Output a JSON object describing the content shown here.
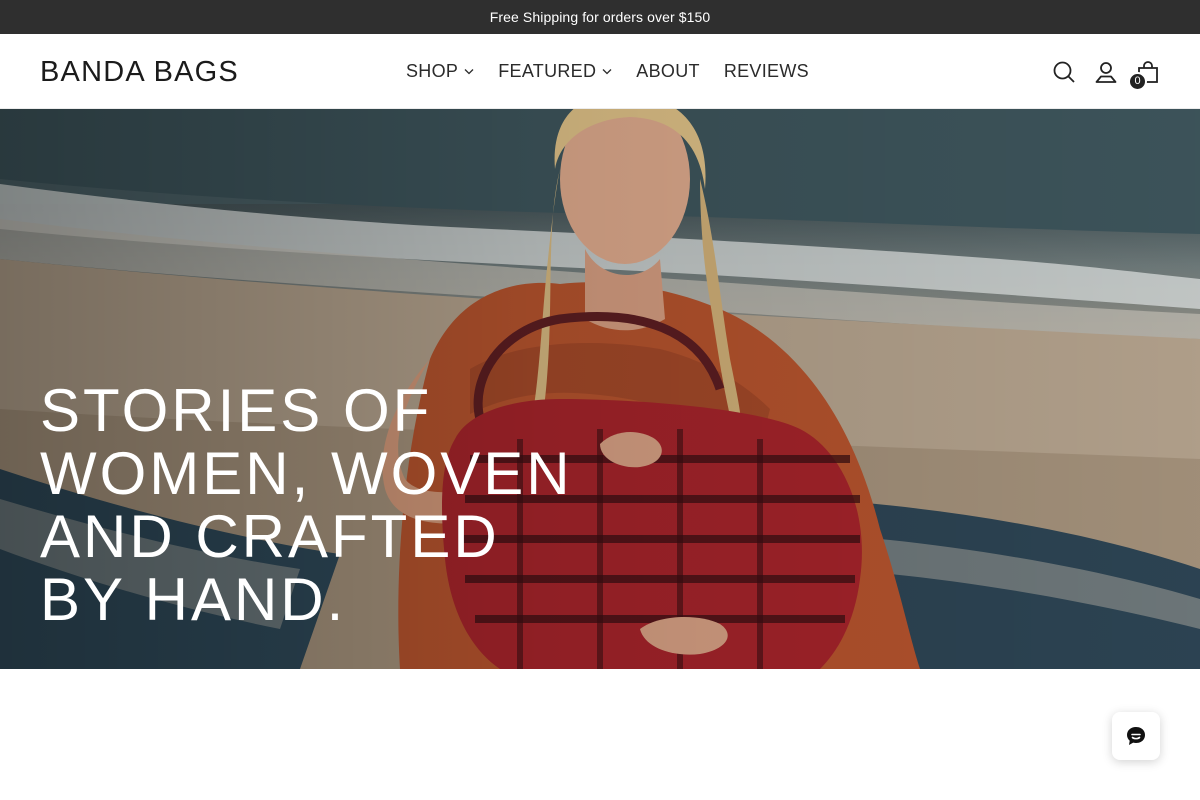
{
  "announcement": {
    "text": "Free Shipping for orders over $150"
  },
  "header": {
    "logo": "BANDA BAGS",
    "nav": [
      {
        "label": "SHOP",
        "has_dropdown": true
      },
      {
        "label": "FEATURED",
        "has_dropdown": true
      },
      {
        "label": "ABOUT",
        "has_dropdown": false
      },
      {
        "label": "REVIEWS",
        "has_dropdown": false
      }
    ],
    "icons": [
      "search-icon",
      "account-icon",
      "cart-icon"
    ],
    "cart_count": "0"
  },
  "hero": {
    "heading": "STORIES OF WOMEN, WOVEN AND CRAFTED BY HAND.",
    "image": "woman-with-red-embroidered-bag-on-beach"
  },
  "chat": {
    "icon": "chat-icon"
  },
  "colors": {
    "announcement_bg": "#2f2f2f",
    "text_dark": "#222222",
    "hero_text": "#ffffff",
    "bag_red": "#a8242b"
  }
}
